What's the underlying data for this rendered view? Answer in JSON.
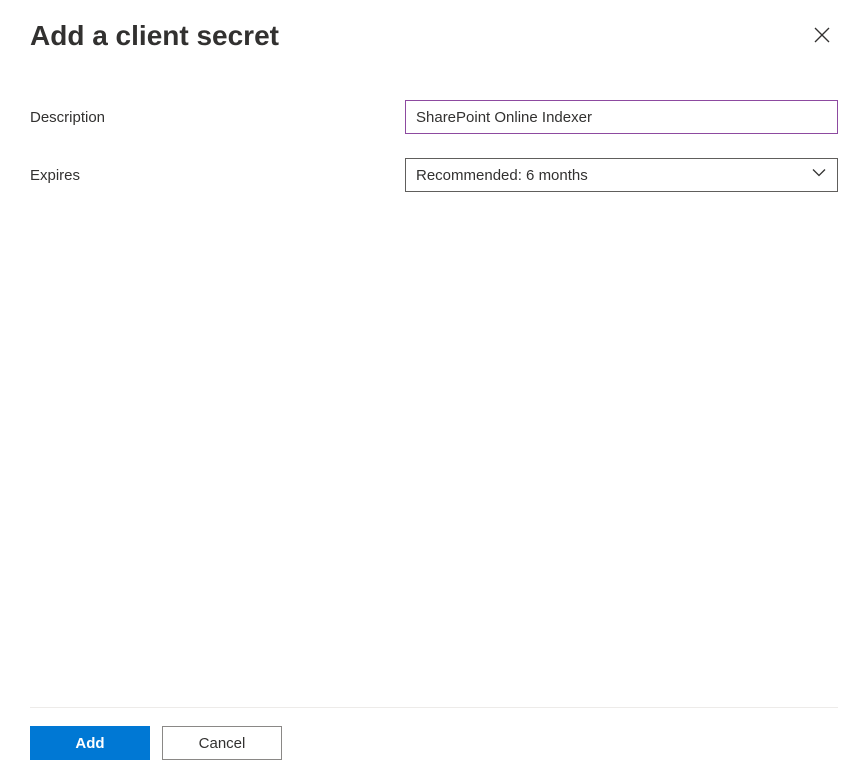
{
  "header": {
    "title": "Add a client secret"
  },
  "form": {
    "description_label": "Description",
    "description_value": "SharePoint Online Indexer",
    "expires_label": "Expires",
    "expires_value": "Recommended: 6 months"
  },
  "footer": {
    "add_label": "Add",
    "cancel_label": "Cancel"
  }
}
